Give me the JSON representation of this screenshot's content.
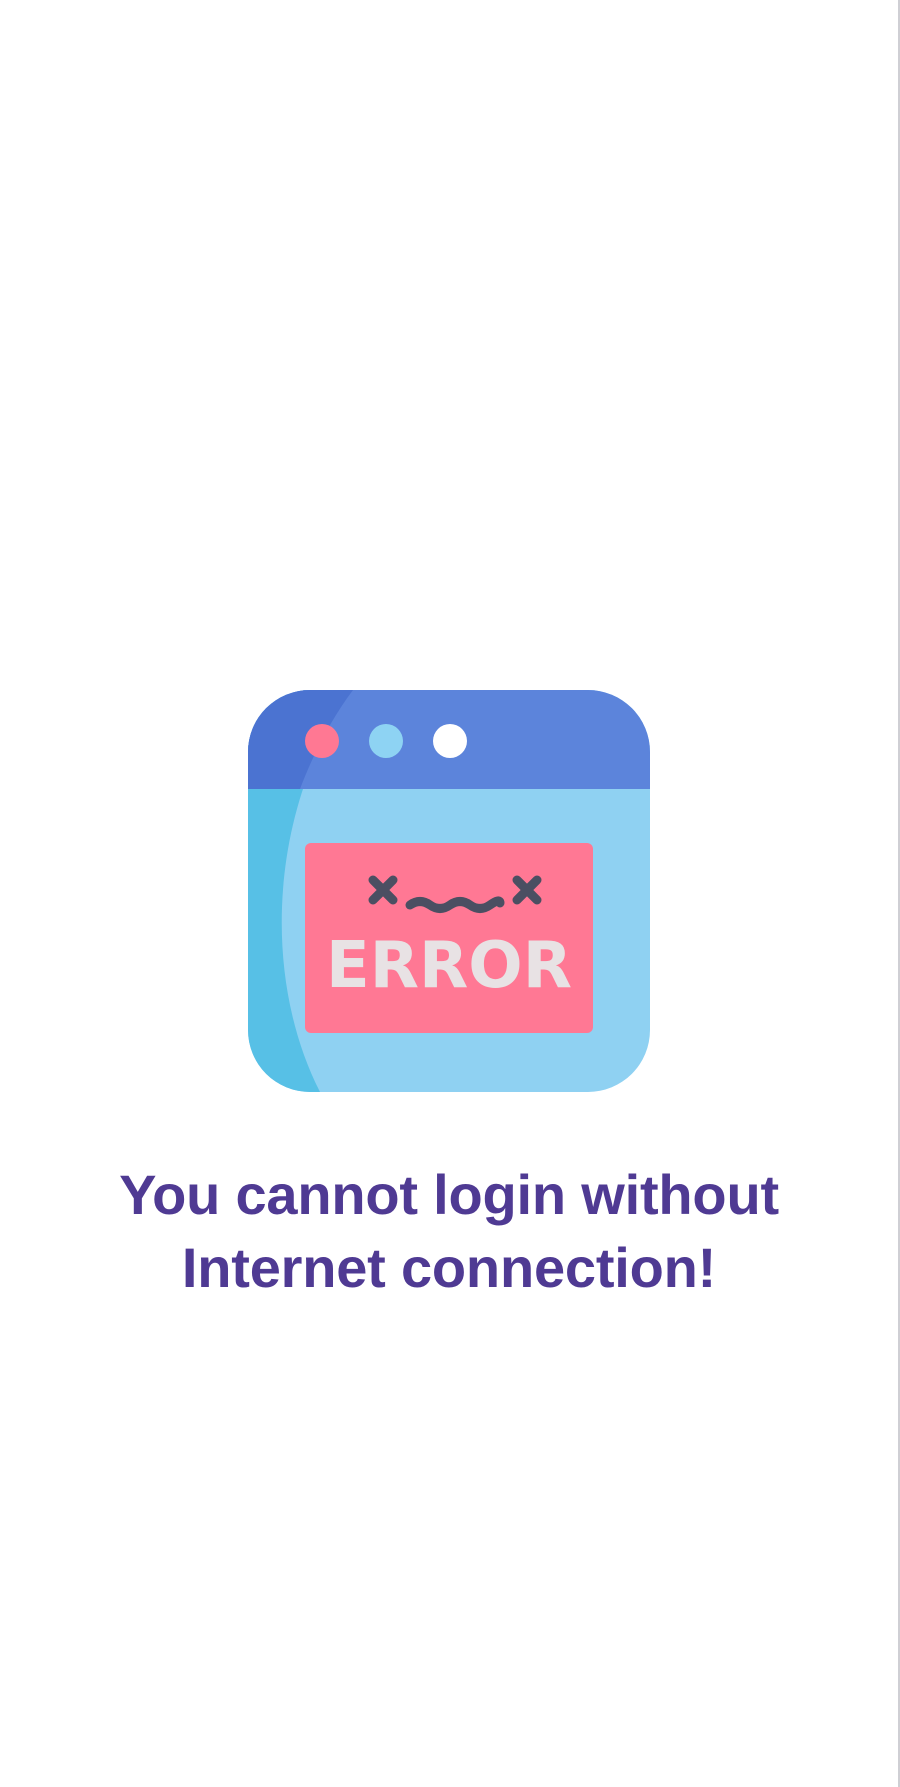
{
  "error_screen": {
    "illustration": {
      "icon": "browser-error-icon",
      "label": "ERROR",
      "colors": {
        "title_bar": "#5c84db",
        "window_body": "#8fd1f2",
        "window_body_shadow": "#57c0e6",
        "error_panel": "#ff7894",
        "error_text": "#e8e2e4",
        "face": "#4b4f62",
        "dot_red": "#ff7893",
        "dot_blue": "#8ed3f3",
        "dot_white": "#ffffff"
      }
    },
    "message": "You cannot login without Internet connection!",
    "colors": {
      "message": "#4f3a93",
      "background": "#ffffff"
    }
  }
}
